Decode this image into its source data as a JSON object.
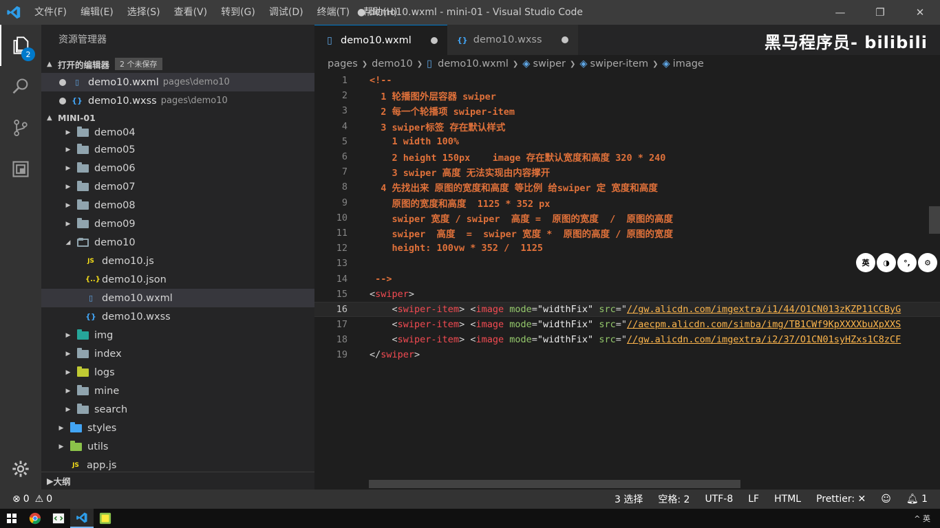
{
  "titlebar": {
    "menu": [
      "文件(F)",
      "编辑(E)",
      "选择(S)",
      "查看(V)",
      "转到(G)",
      "调试(D)",
      "终端(T)",
      "帮助(H)"
    ],
    "title": "● demo10.wxml - mini-01 - Visual Studio Code",
    "controls": [
      "—",
      "❐",
      "✕"
    ]
  },
  "activity": {
    "explorer_badge": "2"
  },
  "sidebar": {
    "title": "资源管理器",
    "open_editors": {
      "header": "打开的编辑器",
      "unsaved": "2 个未保存",
      "items": [
        {
          "name": "demo10.wxml",
          "path": "pages\\demo10"
        },
        {
          "name": "demo10.wxss",
          "path": "pages\\demo10"
        }
      ]
    },
    "project": "MINI-01",
    "tree": [
      {
        "name": "demo04"
      },
      {
        "name": "demo05"
      },
      {
        "name": "demo06"
      },
      {
        "name": "demo07"
      },
      {
        "name": "demo08"
      },
      {
        "name": "demo09"
      },
      {
        "name": "demo10"
      },
      {
        "name": "demo10.js"
      },
      {
        "name": "demo10.json"
      },
      {
        "name": "demo10.wxml"
      },
      {
        "name": "demo10.wxss"
      },
      {
        "name": "img"
      },
      {
        "name": "index"
      },
      {
        "name": "logs"
      },
      {
        "name": "mine"
      },
      {
        "name": "search"
      },
      {
        "name": "styles"
      },
      {
        "name": "utils"
      },
      {
        "name": "app.js"
      }
    ],
    "outline": "大纲"
  },
  "tabs": [
    {
      "label": "demo10.wxml",
      "icon": "file-icon"
    },
    {
      "label": "demo10.wxss",
      "icon": "css-icon"
    }
  ],
  "watermark": "黑马程序员- bilibili",
  "breadcrumb": [
    "pages",
    "demo10",
    "demo10.wxml",
    "swiper",
    "swiper-item",
    "image"
  ],
  "code": {
    "line_numbers": [
      "1",
      "2",
      "3",
      "4",
      "5",
      "6",
      "7",
      "8",
      "9",
      "10",
      "11",
      "12",
      "13",
      "14",
      "15",
      "16",
      "17",
      "18",
      "19"
    ],
    "comment_lines": [
      "<!--",
      "  1 轮播图外层容器 swiper",
      "  2 每一个轮播项 swiper-item",
      "  3 swiper标签 存在默认样式",
      "    1 width 100%",
      "    2 height 150px    image 存在默认宽度和高度 320 * 240",
      "    3 swiper 高度 无法实现由内容撑开",
      "  4 先找出来 原图的宽度和高度 等比例 给swiper 定 宽度和高度",
      "    原图的宽度和高度  1125 * 352 px",
      "    swiper 宽度 / swiper  高度 =  原图的宽度  /  原图的高度",
      "    swiper  高度  =  swiper 宽度 *  原图的高度 / 原图的宽度",
      "    height: 100vw * 352 /  1125",
      "",
      " -->"
    ],
    "swiper_tag": "swiper",
    "item_tag": "swiper-item",
    "image_tag": "image",
    "mode_attr": "mode",
    "mode_value": "\"widthFix\"",
    "src_attr": "src",
    "urls": [
      "//gw.alicdn.com/imgextra/i1/44/O1CN013zKZP11CCByG",
      "//aecpm.alicdn.com/simba/img/TB1CWf9KpXXXXbuXpXXS",
      "//gw.alicdn.com/imgextra/i2/37/O1CN01syHZxs1C8zCF"
    ]
  },
  "ime_buttons": [
    "英",
    "◑",
    "°,",
    "⚙"
  ],
  "status": {
    "errors": "0",
    "warnings": "0",
    "selection": "3 选择",
    "indent": "空格: 2",
    "encoding": "UTF-8",
    "eol": "LF",
    "language": "HTML",
    "formatter": "Prettier: ✕",
    "notifications": "1"
  },
  "taskbar": {
    "tray": "^  英"
  }
}
